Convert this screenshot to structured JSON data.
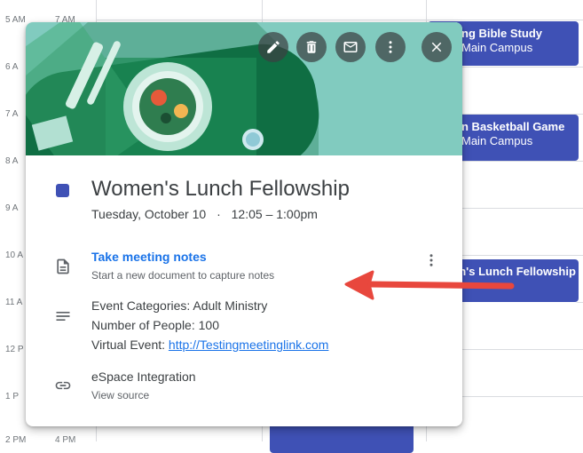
{
  "calendar": {
    "time_labels": [
      "5 AM",
      "6 A",
      "7 A",
      "8 A",
      "9 A",
      "10 A",
      "11 A",
      "12 P",
      "1 P",
      "2 PM"
    ],
    "time_labels_2": [
      "7 AM",
      "4 PM"
    ],
    "events": [
      {
        "title": "ng Bible Study",
        "subtitle": "Main Campus"
      },
      {
        "title": "n Basketball Game",
        "subtitle": "Main Campus"
      },
      {
        "title": "en's Lunch Fellowship",
        "subtitle": ""
      }
    ],
    "event_color": "#3f51b5"
  },
  "popup": {
    "actions": [
      {
        "name": "edit",
        "icon": "pencil-icon"
      },
      {
        "name": "delete",
        "icon": "trash-icon"
      },
      {
        "name": "email",
        "icon": "mail-icon"
      },
      {
        "name": "more",
        "icon": "more-vert-icon"
      },
      {
        "name": "close",
        "icon": "close-icon"
      }
    ],
    "header_color": "#81cbbf",
    "title": "Women's Lunch Fellowship",
    "date": "Tuesday, October 10",
    "separator": "·",
    "time": "12:05 – 1:00pm",
    "notes": {
      "link": "Take meeting notes",
      "subtitle": "Start a new document to capture notes",
      "icon": "document-icon"
    },
    "description": {
      "icon": "notes-lines-icon",
      "categories": "Event Categories: Adult Ministry",
      "people": "Number of People: 100",
      "virtual_label": "Virtual Event: ",
      "virtual_link": "http://Testingmeetinglink.com"
    },
    "integration": {
      "icon": "link-icon",
      "title": "eSpace Integration",
      "subtitle": "View source"
    }
  },
  "annotation": {
    "type": "red-arrow",
    "color": "#e8473d"
  }
}
